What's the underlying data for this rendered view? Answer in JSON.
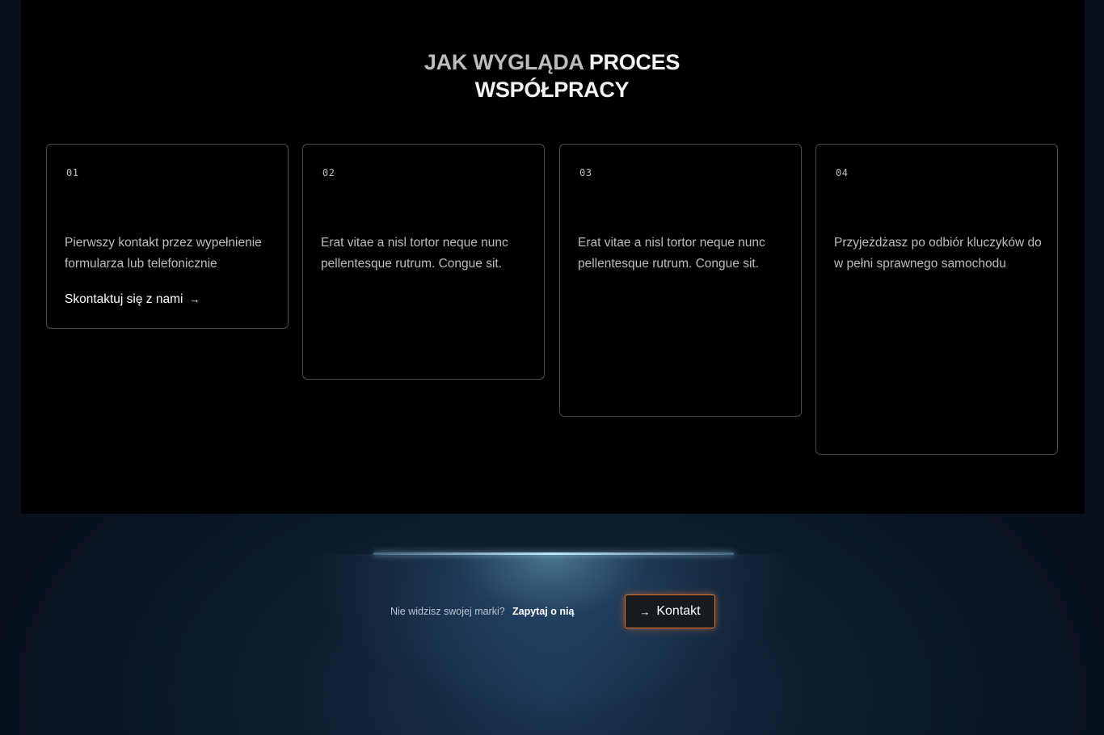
{
  "section": {
    "title_part1": "JAK WYGLĄDA",
    "title_part2": "PROCES",
    "title_line2": "WSPÓŁPRACY"
  },
  "steps": [
    {
      "number": "01",
      "description": "Pierwszy kontakt przez wypełnienie formularza lub telefonicznie",
      "link_label": "Skontaktuj się z nami",
      "link_icon": "arrow-right-icon"
    },
    {
      "number": "02",
      "description": "Erat vitae a nisl tortor neque nunc pellentesque rutrum. Congue sit."
    },
    {
      "number": "03",
      "description": "Erat vitae a nisl tortor neque nunc pellentesque rutrum. Congue sit."
    },
    {
      "number": "04",
      "description": "Przyjeżdżasz po odbiór kluczyków do w pełni sprawnego samochodu"
    }
  ],
  "cta": {
    "question": "Nie widzisz swojej marki?",
    "ask_link": "Zapytaj o nią",
    "button_label": "Kontakt",
    "button_icon": "arrow-right-icon"
  },
  "colors": {
    "background": "#000000",
    "accent": "#e0752e",
    "glow": "#bfe7f7"
  }
}
